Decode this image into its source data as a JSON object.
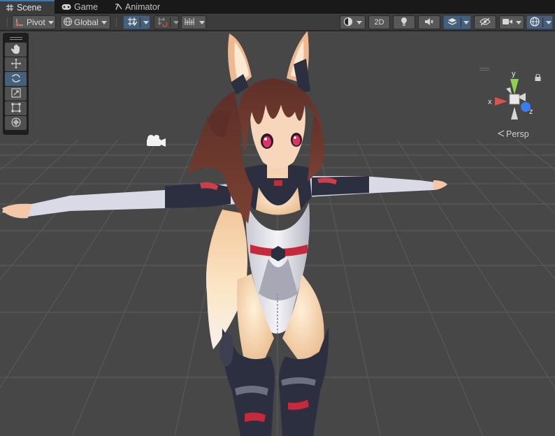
{
  "tabs": [
    {
      "label": "Scene",
      "icon": "grid-hash-icon",
      "active": true
    },
    {
      "label": "Game",
      "icon": "gamepad-icon",
      "active": false
    },
    {
      "label": "Animator",
      "icon": "animator-icon",
      "active": false
    }
  ],
  "toolbar": {
    "pivot_label": "Pivot",
    "global_label": "Global",
    "two_d_label": "2D",
    "accent_color": "#46607c"
  },
  "tools": [
    {
      "name": "hand-tool",
      "icon": "hand-icon",
      "active": false
    },
    {
      "name": "move-tool",
      "icon": "move-arrows-icon",
      "active": false
    },
    {
      "name": "rotate-tool",
      "icon": "rotate-icon",
      "active": true
    },
    {
      "name": "scale-tool",
      "icon": "scale-icon",
      "active": false
    },
    {
      "name": "rect-tool",
      "icon": "rect-transform-icon",
      "active": false
    },
    {
      "name": "transform-tool",
      "icon": "transform-icon",
      "active": false
    }
  ],
  "gizmo": {
    "y_label": "y",
    "x_label": "x",
    "z_label": "z",
    "colors": {
      "x": "#d9534f",
      "y": "#8fd14f",
      "z": "#3b7df0"
    }
  },
  "projection_label": "Persp"
}
